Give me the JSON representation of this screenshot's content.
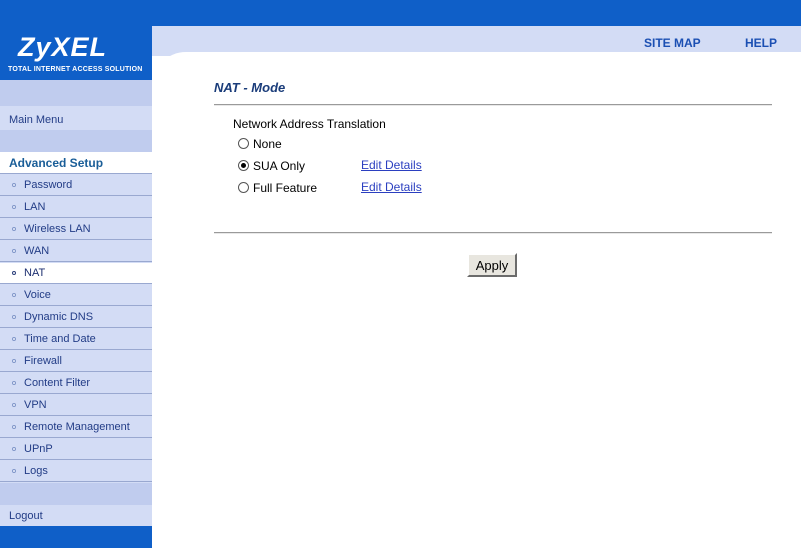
{
  "logo": {
    "brand": "ZyXEL",
    "tagline": "TOTAL INTERNET ACCESS SOLUTION"
  },
  "header": {
    "site_map": "SITE MAP",
    "help": "HELP"
  },
  "sidebar": {
    "main_menu": "Main Menu",
    "advanced_setup": "Advanced Setup",
    "items": [
      {
        "label": "Password"
      },
      {
        "label": "LAN"
      },
      {
        "label": "Wireless LAN"
      },
      {
        "label": "WAN"
      },
      {
        "label": "NAT"
      },
      {
        "label": "Voice"
      },
      {
        "label": "Dynamic DNS"
      },
      {
        "label": "Time and Date"
      },
      {
        "label": "Firewall"
      },
      {
        "label": "Content Filter"
      },
      {
        "label": "VPN"
      },
      {
        "label": "Remote Management"
      },
      {
        "label": "UPnP"
      },
      {
        "label": "Logs"
      }
    ],
    "active_item": "NAT",
    "logout": "Logout"
  },
  "main": {
    "title": "NAT - Mode",
    "section_label": "Network Address Translation",
    "options": [
      {
        "label": "None",
        "selected": false
      },
      {
        "label": "SUA Only",
        "selected": true,
        "link": "Edit Details"
      },
      {
        "label": "Full Feature",
        "selected": false,
        "link": "Edit Details"
      }
    ],
    "apply_label": "Apply"
  },
  "colors": {
    "brand_blue": "#0f5fc8",
    "sidebar_bg": "#d3dcf5",
    "link": "#2b3fc0"
  }
}
